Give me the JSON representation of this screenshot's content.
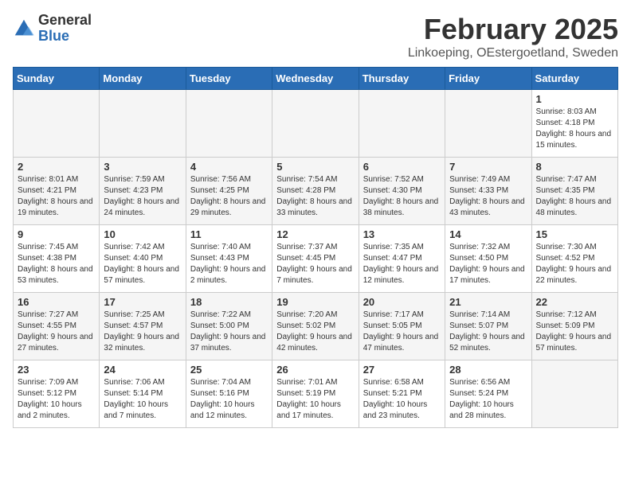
{
  "header": {
    "logo_general": "General",
    "logo_blue": "Blue",
    "month_year": "February 2025",
    "location": "Linkoeping, OEstergoetland, Sweden"
  },
  "weekdays": [
    "Sunday",
    "Monday",
    "Tuesday",
    "Wednesday",
    "Thursday",
    "Friday",
    "Saturday"
  ],
  "weeks": [
    [
      {
        "day": "",
        "detail": ""
      },
      {
        "day": "",
        "detail": ""
      },
      {
        "day": "",
        "detail": ""
      },
      {
        "day": "",
        "detail": ""
      },
      {
        "day": "",
        "detail": ""
      },
      {
        "day": "",
        "detail": ""
      },
      {
        "day": "1",
        "detail": "Sunrise: 8:03 AM\nSunset: 4:18 PM\nDaylight: 8 hours and 15 minutes."
      }
    ],
    [
      {
        "day": "2",
        "detail": "Sunrise: 8:01 AM\nSunset: 4:21 PM\nDaylight: 8 hours and 19 minutes."
      },
      {
        "day": "3",
        "detail": "Sunrise: 7:59 AM\nSunset: 4:23 PM\nDaylight: 8 hours and 24 minutes."
      },
      {
        "day": "4",
        "detail": "Sunrise: 7:56 AM\nSunset: 4:25 PM\nDaylight: 8 hours and 29 minutes."
      },
      {
        "day": "5",
        "detail": "Sunrise: 7:54 AM\nSunset: 4:28 PM\nDaylight: 8 hours and 33 minutes."
      },
      {
        "day": "6",
        "detail": "Sunrise: 7:52 AM\nSunset: 4:30 PM\nDaylight: 8 hours and 38 minutes."
      },
      {
        "day": "7",
        "detail": "Sunrise: 7:49 AM\nSunset: 4:33 PM\nDaylight: 8 hours and 43 minutes."
      },
      {
        "day": "8",
        "detail": "Sunrise: 7:47 AM\nSunset: 4:35 PM\nDaylight: 8 hours and 48 minutes."
      }
    ],
    [
      {
        "day": "9",
        "detail": "Sunrise: 7:45 AM\nSunset: 4:38 PM\nDaylight: 8 hours and 53 minutes."
      },
      {
        "day": "10",
        "detail": "Sunrise: 7:42 AM\nSunset: 4:40 PM\nDaylight: 8 hours and 57 minutes."
      },
      {
        "day": "11",
        "detail": "Sunrise: 7:40 AM\nSunset: 4:43 PM\nDaylight: 9 hours and 2 minutes."
      },
      {
        "day": "12",
        "detail": "Sunrise: 7:37 AM\nSunset: 4:45 PM\nDaylight: 9 hours and 7 minutes."
      },
      {
        "day": "13",
        "detail": "Sunrise: 7:35 AM\nSunset: 4:47 PM\nDaylight: 9 hours and 12 minutes."
      },
      {
        "day": "14",
        "detail": "Sunrise: 7:32 AM\nSunset: 4:50 PM\nDaylight: 9 hours and 17 minutes."
      },
      {
        "day": "15",
        "detail": "Sunrise: 7:30 AM\nSunset: 4:52 PM\nDaylight: 9 hours and 22 minutes."
      }
    ],
    [
      {
        "day": "16",
        "detail": "Sunrise: 7:27 AM\nSunset: 4:55 PM\nDaylight: 9 hours and 27 minutes."
      },
      {
        "day": "17",
        "detail": "Sunrise: 7:25 AM\nSunset: 4:57 PM\nDaylight: 9 hours and 32 minutes."
      },
      {
        "day": "18",
        "detail": "Sunrise: 7:22 AM\nSunset: 5:00 PM\nDaylight: 9 hours and 37 minutes."
      },
      {
        "day": "19",
        "detail": "Sunrise: 7:20 AM\nSunset: 5:02 PM\nDaylight: 9 hours and 42 minutes."
      },
      {
        "day": "20",
        "detail": "Sunrise: 7:17 AM\nSunset: 5:05 PM\nDaylight: 9 hours and 47 minutes."
      },
      {
        "day": "21",
        "detail": "Sunrise: 7:14 AM\nSunset: 5:07 PM\nDaylight: 9 hours and 52 minutes."
      },
      {
        "day": "22",
        "detail": "Sunrise: 7:12 AM\nSunset: 5:09 PM\nDaylight: 9 hours and 57 minutes."
      }
    ],
    [
      {
        "day": "23",
        "detail": "Sunrise: 7:09 AM\nSunset: 5:12 PM\nDaylight: 10 hours and 2 minutes."
      },
      {
        "day": "24",
        "detail": "Sunrise: 7:06 AM\nSunset: 5:14 PM\nDaylight: 10 hours and 7 minutes."
      },
      {
        "day": "25",
        "detail": "Sunrise: 7:04 AM\nSunset: 5:16 PM\nDaylight: 10 hours and 12 minutes."
      },
      {
        "day": "26",
        "detail": "Sunrise: 7:01 AM\nSunset: 5:19 PM\nDaylight: 10 hours and 17 minutes."
      },
      {
        "day": "27",
        "detail": "Sunrise: 6:58 AM\nSunset: 5:21 PM\nDaylight: 10 hours and 23 minutes."
      },
      {
        "day": "28",
        "detail": "Sunrise: 6:56 AM\nSunset: 5:24 PM\nDaylight: 10 hours and 28 minutes."
      },
      {
        "day": "",
        "detail": ""
      }
    ]
  ]
}
